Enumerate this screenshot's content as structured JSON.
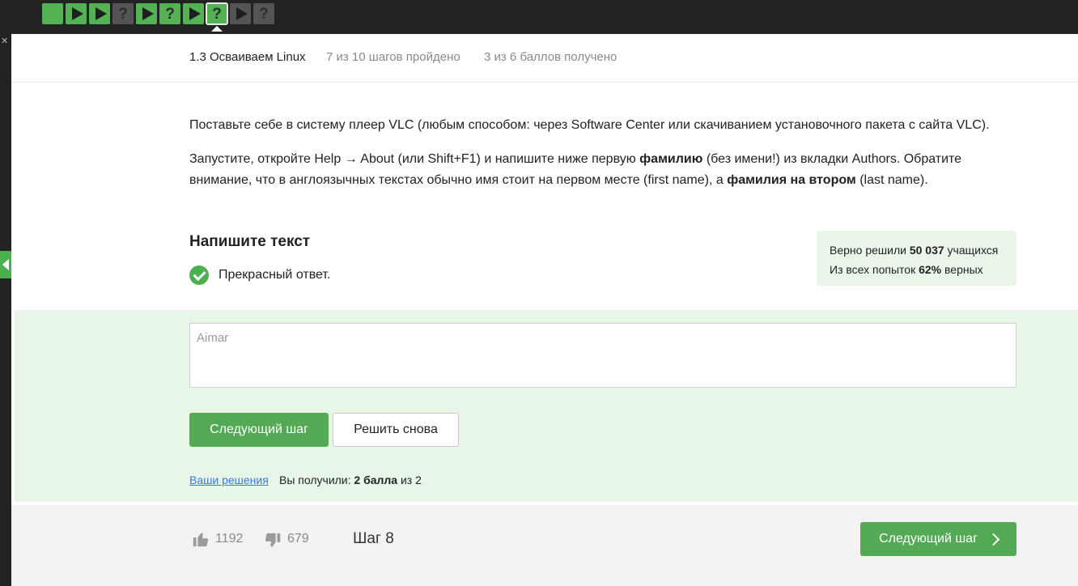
{
  "steps": [
    {
      "type": "theory",
      "state": "done"
    },
    {
      "type": "video",
      "state": "done"
    },
    {
      "type": "video",
      "state": "done"
    },
    {
      "type": "question",
      "state": "pending",
      "label": "?"
    },
    {
      "type": "video",
      "state": "done"
    },
    {
      "type": "question",
      "state": "done",
      "label": "?"
    },
    {
      "type": "video",
      "state": "done"
    },
    {
      "type": "question",
      "state": "current",
      "label": "?"
    },
    {
      "type": "video",
      "state": "pending"
    },
    {
      "type": "question",
      "state": "pending",
      "label": "?"
    }
  ],
  "header": {
    "lesson": "1.3 Осваиваем Linux",
    "progress": "7 из 10 шагов пройдено",
    "score": "3 из 6 баллов  получено"
  },
  "content": {
    "p1": "Поставьте себе в систему плеер VLC (любым способом: через Software Center или скачиванием установочного пакета с сайта VLC).",
    "p2_a": "Запустите, откройте Help → About (или Shift+F1) и напишите ниже первую ",
    "p2_b": "фамилию",
    "p2_c": " (без имени!) из вкладки Authors. Обратите внимание, что в англоязычных текстах обычно имя стоит на первом месте (first name), а ",
    "p2_d": "фамилия на втором",
    "p2_e": " (last name)."
  },
  "task": {
    "title": "Напишите текст",
    "feedback": "Прекрасный ответ."
  },
  "stats": {
    "solved_prefix": "Верно решили ",
    "solved_count": "50 037",
    "solved_suffix": " учащихся",
    "attempts_prefix": "Из всех попыток ",
    "attempts_percent": "62%",
    "attempts_suffix": " верных"
  },
  "answer": {
    "value": "Aimar"
  },
  "buttons": {
    "next": "Следующий шаг",
    "retry": "Решить снова"
  },
  "result": {
    "solutions_link": "Ваши решения",
    "got_prefix": "Вы получили: ",
    "got_points": "2 балла",
    "got_suffix": " из 2"
  },
  "footer": {
    "likes": "1192",
    "dislikes": "679",
    "step": "Шаг 8",
    "next": "Следующий шаг"
  },
  "colors": {
    "accent": "#54a954",
    "success_bg": "#e8f6e8",
    "topbar": "#222222"
  }
}
